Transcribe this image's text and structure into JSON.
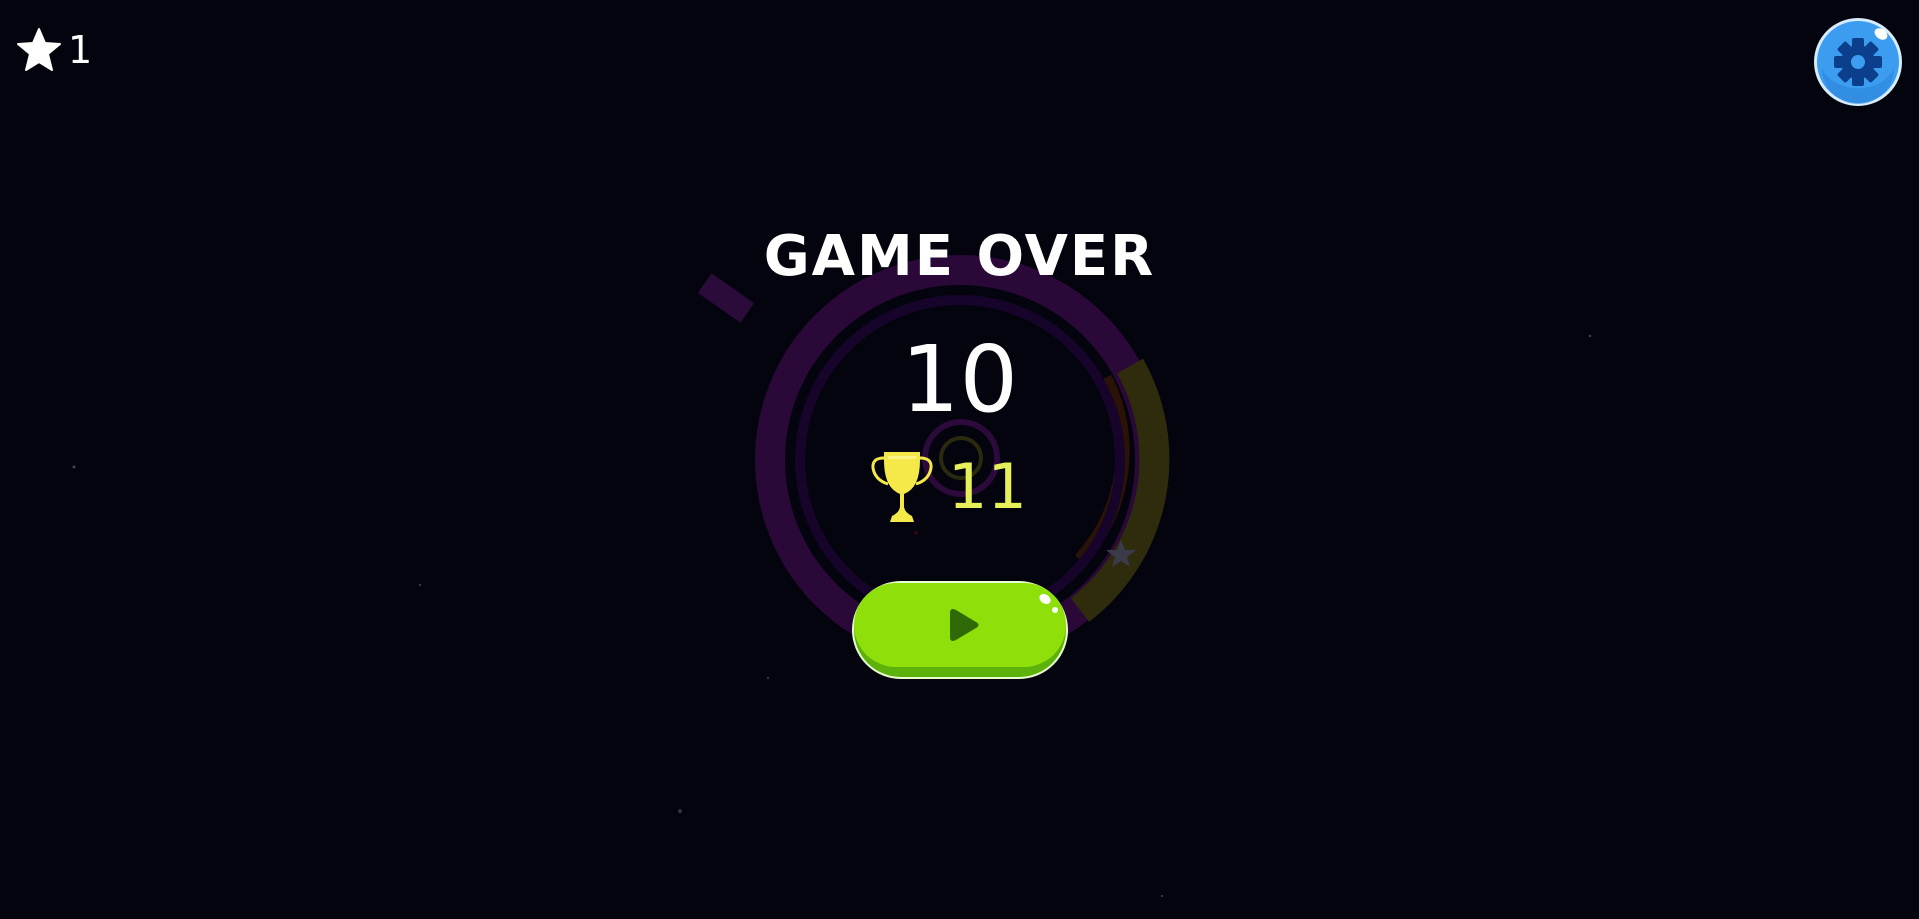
{
  "hud": {
    "stars_collected": "1",
    "star_icon": "star-icon",
    "settings_icon": "gear-icon"
  },
  "game_over": {
    "title": "GAME OVER",
    "score": "10",
    "best_score": "11",
    "trophy_icon": "trophy-icon",
    "play_icon": "play-icon"
  },
  "colors": {
    "background": "#03040d",
    "ring_purple": "#3a0a4a",
    "ring_yellow": "#3b3a10",
    "best_text": "#e6f15a",
    "trophy": "#f5e94a",
    "play_button": "#8fe00b",
    "play_button_dark": "#5cb20a",
    "settings_button": "#3b9cf0"
  }
}
